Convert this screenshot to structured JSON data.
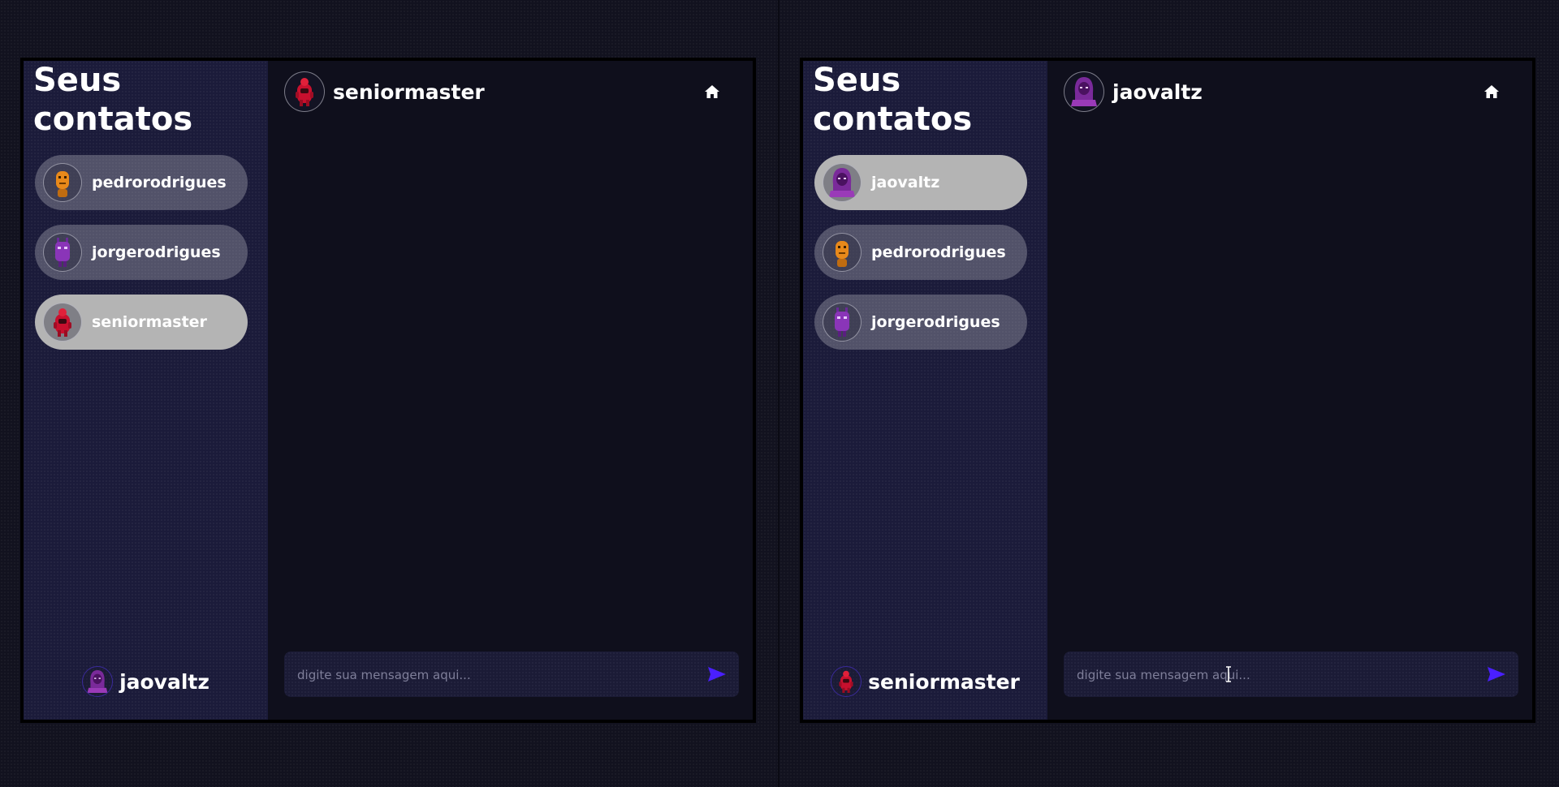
{
  "colors": {
    "background": "#12121f",
    "sidebar": "#1b1b3a",
    "chat": "#0f0f1c",
    "contact_bg": "#6c6c7f",
    "contact_selected_bg": "#b4b4b4",
    "send_accent": "#4a1fff"
  },
  "left": {
    "sidebar": {
      "title_line1": "Seus",
      "title_line2": "contatos",
      "contacts": [
        {
          "name": "pedrorodrigues",
          "avatar": "orange-character-icon",
          "selected": false
        },
        {
          "name": "jorgerodrigues",
          "avatar": "purple-character-icon",
          "selected": false
        },
        {
          "name": "seniormaster",
          "avatar": "red-character-icon",
          "selected": true
        }
      ],
      "current_user": {
        "name": "jaovaltz",
        "avatar": "purple-hooded-character-icon"
      }
    },
    "chat": {
      "title": "seniormaster",
      "avatar": "red-character-icon",
      "home_icon": "home-icon",
      "input_placeholder": "digite sua mensagem aqui...",
      "send_icon": "send-arrow-icon"
    }
  },
  "right": {
    "sidebar": {
      "title_line1": "Seus",
      "title_line2": "contatos",
      "contacts": [
        {
          "name": "jaovaltz",
          "avatar": "purple-hooded-character-icon",
          "selected": true
        },
        {
          "name": "pedrorodrigues",
          "avatar": "orange-character-icon",
          "selected": false
        },
        {
          "name": "jorgerodrigues",
          "avatar": "purple-character-icon",
          "selected": false
        }
      ],
      "current_user": {
        "name": "seniormaster",
        "avatar": "red-character-icon"
      }
    },
    "chat": {
      "title": "jaovaltz",
      "avatar": "purple-hooded-character-icon",
      "home_icon": "home-icon",
      "input_placeholder": "digite sua mensagem aqui...",
      "send_icon": "send-arrow-icon"
    }
  }
}
